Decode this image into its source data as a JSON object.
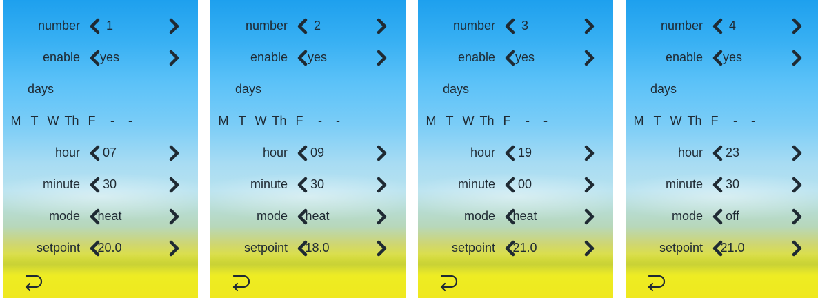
{
  "labels": {
    "number": "number",
    "enable": "enable",
    "days": "days",
    "hour": "hour",
    "minute": "minute",
    "mode": "mode",
    "setpoint": "setpoint"
  },
  "icons": {
    "left": "chevron-left-icon",
    "right": "chevron-right-icon",
    "back": "return-arrow-icon"
  },
  "colors": {
    "text": "#1f2a33",
    "sky_top": "#1ea0ee",
    "grass": "#efe81f"
  },
  "panels": [
    {
      "number": "1",
      "enable": "yes",
      "days": [
        "M",
        "T",
        "W",
        "Th",
        "F",
        "-",
        "-"
      ],
      "hour": "07",
      "minute": "30",
      "mode": "heat",
      "setpoint": "20.0"
    },
    {
      "number": "2",
      "enable": "yes",
      "days": [
        "M",
        "T",
        "W",
        "Th",
        "F",
        "-",
        "-"
      ],
      "hour": "09",
      "minute": "30",
      "mode": "heat",
      "setpoint": "18.0"
    },
    {
      "number": "3",
      "enable": "yes",
      "days": [
        "M",
        "T",
        "W",
        "Th",
        "F",
        "-",
        "-"
      ],
      "hour": "19",
      "minute": "00",
      "mode": "heat",
      "setpoint": "21.0"
    },
    {
      "number": "4",
      "enable": "yes",
      "days": [
        "M",
        "T",
        "W",
        "Th",
        "F",
        "-",
        "-"
      ],
      "hour": "23",
      "minute": "30",
      "mode": "off",
      "setpoint": "21.0"
    }
  ]
}
